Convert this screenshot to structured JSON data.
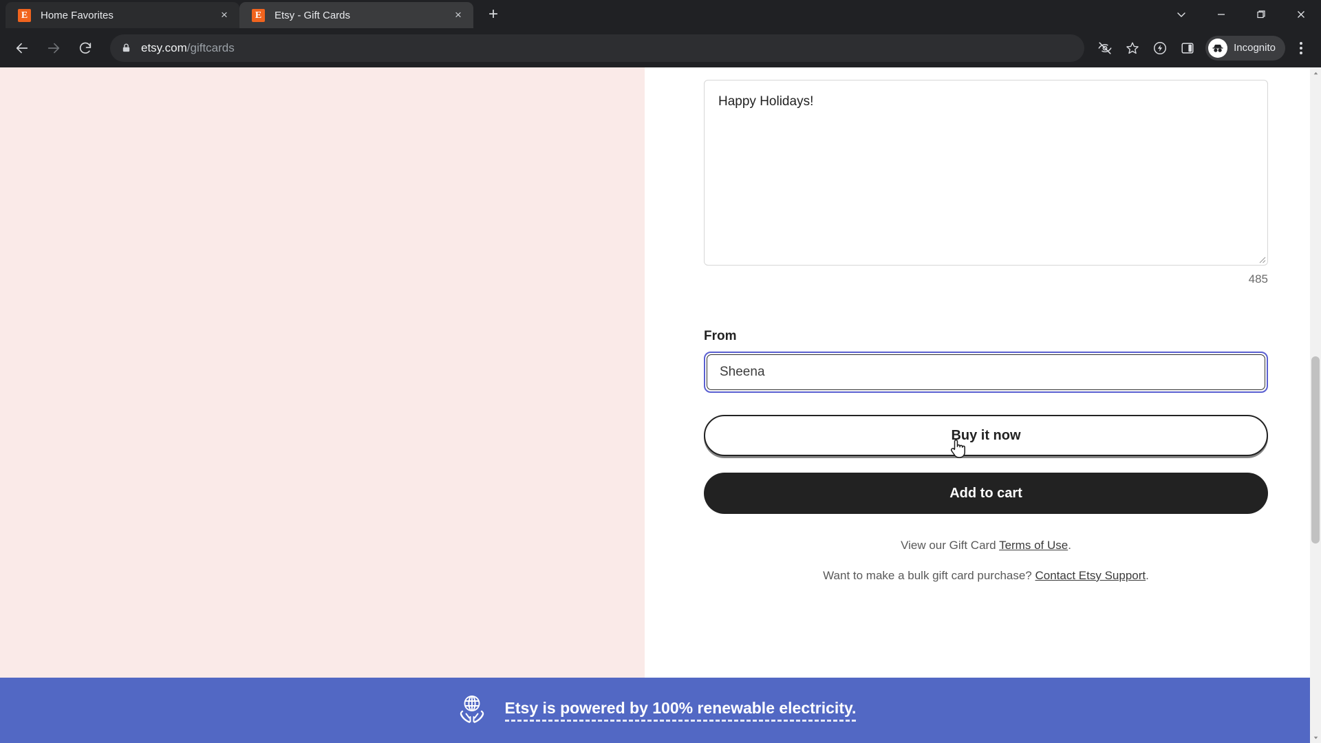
{
  "browser": {
    "tabs": [
      {
        "title": "Home Favorites",
        "favicon": "etsy-favicon",
        "active": false,
        "close_label": "×"
      },
      {
        "title": "Etsy - Gift Cards",
        "favicon": "etsy-favicon",
        "active": true,
        "close_label": "×"
      }
    ],
    "new_tab_label": "+",
    "window_controls": [
      "tab-search-chevron",
      "minimize",
      "maximize",
      "close"
    ],
    "toolbar": {
      "back": "back-arrow",
      "forward": "forward-arrow",
      "reload": "reload-arrow",
      "url_host": "etsy.com",
      "url_path": "/giftcards",
      "lock_icon": "lock-icon",
      "icons": [
        "tracking-protection-eye-slash",
        "bookmark-star",
        "browser-essentials",
        "side-panel"
      ],
      "profile_label": "Incognito",
      "menu": "three-dot-menu"
    }
  },
  "page": {
    "message": {
      "value": "Happy Holidays!",
      "placeholder": "Write your message here",
      "char_count": "485"
    },
    "from": {
      "label": "From",
      "value": "Sheena",
      "placeholder": "Your name"
    },
    "actions": {
      "buy_now": "Buy it now",
      "add_to_cart": "Add to cart"
    },
    "legal": {
      "line1_before": "View our Gift Card ",
      "line1_link": "Terms of Use",
      "line1_after": ".",
      "line2_before": "Want to make a bulk gift card purchase? ",
      "line2_link": "Contact Etsy Support",
      "line2_after": "."
    },
    "eco_banner": {
      "icon": "globe-in-hands-icon",
      "text": "Etsy is powered by 100% renewable electricity."
    },
    "colors": {
      "left_panel": "#faeae8",
      "eco_banner": "#5268c4",
      "focus_ring": "#5a5fd0",
      "dark_button": "#222222",
      "etsy_orange": "#f1641e"
    }
  }
}
